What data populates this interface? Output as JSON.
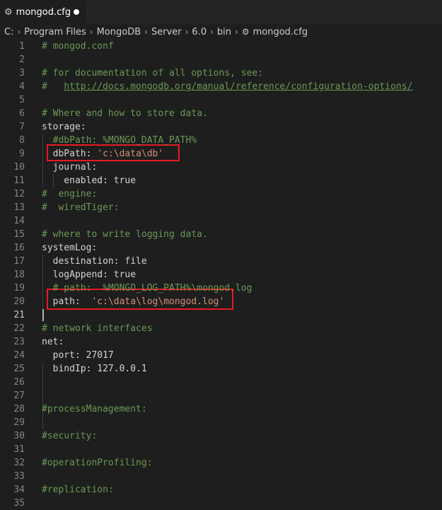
{
  "tab": {
    "filename": "mongod.cfg"
  },
  "breadcrumb": [
    "C:",
    "Program Files",
    "MongoDB",
    "Server",
    "6.0",
    "bin",
    "mongod.cfg"
  ],
  "lines": [
    {
      "n": "1",
      "parts": [
        {
          "t": "# mongod.conf",
          "c": "comment"
        }
      ]
    },
    {
      "n": "2",
      "parts": []
    },
    {
      "n": "3",
      "parts": [
        {
          "t": "# for documentation of all options, see:",
          "c": "comment"
        }
      ]
    },
    {
      "n": "4",
      "parts": [
        {
          "t": "#   ",
          "c": "comment"
        },
        {
          "t": "http://docs.mongodb.org/manual/reference/configuration-options/",
          "c": "link"
        }
      ]
    },
    {
      "n": "5",
      "parts": []
    },
    {
      "n": "6",
      "parts": [
        {
          "t": "# Where and how to store data.",
          "c": "comment"
        }
      ]
    },
    {
      "n": "7",
      "parts": [
        {
          "t": "storage:",
          "c": "key"
        }
      ]
    },
    {
      "n": "8",
      "parts": [
        {
          "t": "  #dbPath: %MONGO_DATA_PATH%",
          "c": "comment"
        }
      ]
    },
    {
      "n": "9",
      "parts": [
        {
          "t": "  dbPath: ",
          "c": "key"
        },
        {
          "t": "'c:\\data\\db'",
          "c": "str"
        }
      ]
    },
    {
      "n": "10",
      "parts": [
        {
          "t": "  journal:",
          "c": "key"
        }
      ]
    },
    {
      "n": "11",
      "parts": [
        {
          "t": "    enabled: ",
          "c": "key"
        },
        {
          "t": "true",
          "c": "plain"
        }
      ]
    },
    {
      "n": "12",
      "parts": [
        {
          "t": "#  engine:",
          "c": "comment"
        }
      ]
    },
    {
      "n": "13",
      "parts": [
        {
          "t": "#  wiredTiger:",
          "c": "comment"
        }
      ]
    },
    {
      "n": "14",
      "parts": []
    },
    {
      "n": "15",
      "parts": [
        {
          "t": "# where to write logging data.",
          "c": "comment"
        }
      ]
    },
    {
      "n": "16",
      "parts": [
        {
          "t": "systemLog:",
          "c": "key"
        }
      ]
    },
    {
      "n": "17",
      "parts": [
        {
          "t": "  destination: ",
          "c": "key"
        },
        {
          "t": "file",
          "c": "plain"
        }
      ]
    },
    {
      "n": "18",
      "parts": [
        {
          "t": "  logAppend: ",
          "c": "key"
        },
        {
          "t": "true",
          "c": "plain"
        }
      ]
    },
    {
      "n": "19",
      "parts": [
        {
          "t": "  # path:  %MONGO_LOG_PATH%\\mongod.log",
          "c": "comment"
        }
      ]
    },
    {
      "n": "20",
      "parts": [
        {
          "t": "  path:  ",
          "c": "key"
        },
        {
          "t": "'c:\\data\\log\\mongod.log'",
          "c": "str"
        }
      ]
    },
    {
      "n": "21",
      "parts": []
    },
    {
      "n": "22",
      "parts": [
        {
          "t": "# network interfaces",
          "c": "comment"
        }
      ]
    },
    {
      "n": "23",
      "parts": [
        {
          "t": "net:",
          "c": "key"
        }
      ]
    },
    {
      "n": "24",
      "parts": [
        {
          "t": "  port: ",
          "c": "key"
        },
        {
          "t": "27017",
          "c": "plain"
        }
      ]
    },
    {
      "n": "25",
      "parts": [
        {
          "t": "  bindIp: ",
          "c": "key"
        },
        {
          "t": "127.0.0.1",
          "c": "plain"
        }
      ]
    },
    {
      "n": "26",
      "parts": []
    },
    {
      "n": "27",
      "parts": []
    },
    {
      "n": "28",
      "parts": [
        {
          "t": "#processManagement:",
          "c": "comment"
        }
      ]
    },
    {
      "n": "29",
      "parts": []
    },
    {
      "n": "30",
      "parts": [
        {
          "t": "#security:",
          "c": "comment"
        }
      ]
    },
    {
      "n": "31",
      "parts": []
    },
    {
      "n": "32",
      "parts": [
        {
          "t": "#operationProfiling:",
          "c": "comment"
        }
      ]
    },
    {
      "n": "33",
      "parts": []
    },
    {
      "n": "34",
      "parts": [
        {
          "t": "#replication:",
          "c": "comment"
        }
      ]
    },
    {
      "n": "35",
      "parts": []
    }
  ],
  "active_line": "21",
  "colors": {
    "highlight_box": "#e51c23",
    "comment": "#6a9955",
    "string": "#ce9178"
  }
}
